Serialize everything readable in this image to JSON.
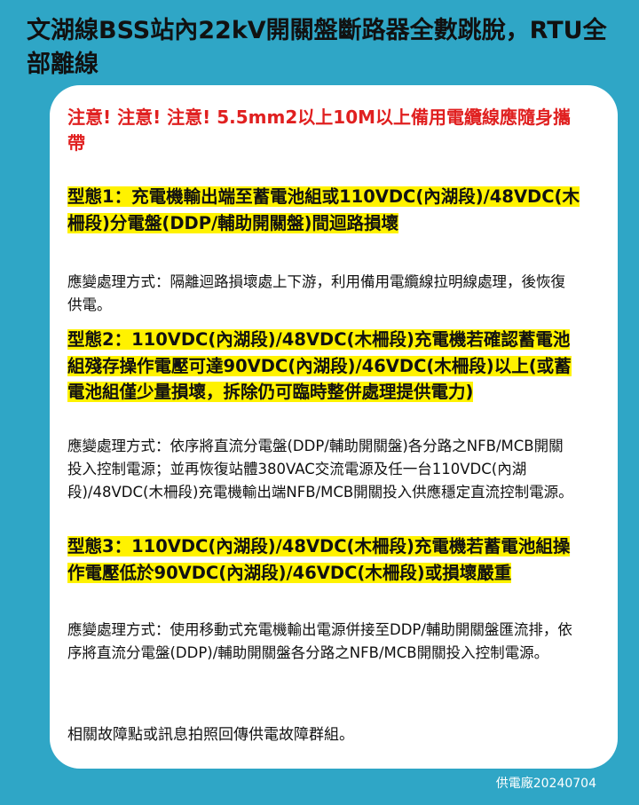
{
  "header": {
    "title": "文湖線BSS站內22kV開關盤斷路器全數跳脫，RTU全部離線"
  },
  "notice": {
    "warning": "注意! 注意! 注意! 5.5mm2以上10M以上備用電纜線應隨身攜帶",
    "types": [
      {
        "heading": "型態1：充電機輸出端至蓄電池組或110VDC(內湖段)/48VDC(木柵段)分電盤(DDP/輔助開關盤)間迴路損壞",
        "response": "應變處理方式：隔離迴路損壞處上下游，利用備用電纜線拉明線處理，後恢復供電。"
      },
      {
        "heading": "型態2：110VDC(內湖段)/48VDC(木柵段)充電機若確認蓄電池組殘存操作電壓可達90VDC(內湖段)/46VDC(木柵段)以上(或蓄電池組僅少量損壞，拆除仍可臨時整併處理提供電力)",
        "response": "應變處理方式：依序將直流分電盤(DDP/輔助開關盤)各分路之NFB/MCB開關投入控制電源；並再恢復站體380VAC交流電源及任一台110VDC(內湖段)/48VDC(木柵段)充電機輸出端NFB/MCB開關投入供應穩定直流控制電源。"
      },
      {
        "heading": "型態3：110VDC(內湖段)/48VDC(木柵段)充電機若蓄電池組操作電壓低於90VDC(內湖段)/46VDC(木柵段)或損壞嚴重",
        "response": "應變處理方式：使用移動式充電機輸出電源併接至DDP/輔助開關盤匯流排，依序將直流分電盤(DDP)/輔助開關盤各分路之NFB/MCB開關投入控制電源。"
      }
    ],
    "footer_note": "相關故障點或訊息拍照回傳供電故障群組。"
  },
  "credit": "供電廠20240704",
  "colors": {
    "background": "#2fa6c6",
    "card": "#ffffff",
    "warning_text": "#e02020",
    "highlight": "#fff200"
  }
}
